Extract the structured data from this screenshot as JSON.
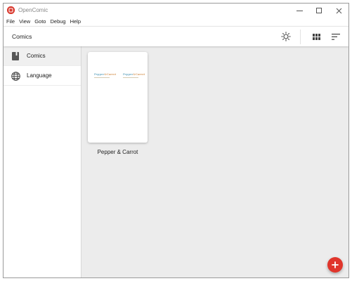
{
  "window": {
    "title": "OpenComic",
    "icon_glyph": "⌖"
  },
  "menu": [
    "File",
    "View",
    "Goto",
    "Debug",
    "Help"
  ],
  "header": {
    "title": "Comics",
    "icons": [
      "theme-brightness-icon",
      "grid-view-icon",
      "sort-icon"
    ]
  },
  "sidebar": {
    "items": [
      {
        "label": "Comics",
        "icon": "book-icon",
        "active": true
      },
      {
        "label": "Language",
        "icon": "globe-icon",
        "active": false
      }
    ]
  },
  "library": {
    "comics": [
      {
        "title": "Pepper & Carrot",
        "cover_logo_a": "Pepper",
        "cover_logo_amp": "&",
        "cover_logo_b": "Carrot"
      }
    ]
  },
  "fab": {
    "icon": "plus-icon"
  },
  "colors": {
    "accent": "#e0352b",
    "background": "#ececec",
    "sidebar_active": "#f0f0f0"
  }
}
